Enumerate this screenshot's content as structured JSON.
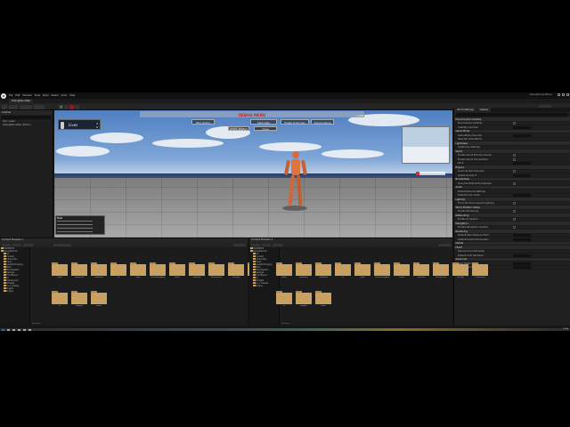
{
  "window": {
    "app_title": "DebugMenuUIMenu",
    "menu": [
      "File",
      "Edit",
      "Window",
      "Tools",
      "Build",
      "Select",
      "Actor",
      "Help"
    ],
    "level_tab": "DebugMenuMap"
  },
  "outliner": {
    "title": "Outliner",
    "rows": [
      "Item Label",
      "DebugMenuMap (Editor)"
    ]
  },
  "viewport": {
    "hud_lives_label": "Lives",
    "hud_lives_value": "3",
    "hud_lives_sub": "0",
    "debug_menu_title": "DEBUG MENU",
    "buttons": [
      "Tab1 Option",
      "Tab2 Opts",
      "Toggle Fullscreen",
      "Toggle Debug"
    ],
    "small_buttons": [
      "LEVEL SELECT",
      "Close"
    ],
    "stats_title": "Stats"
  },
  "details": {
    "tabs": [
      "World Settings",
      "Details"
    ],
    "rows": [
      {
        "label": "Precomputed Visibility",
        "type": "sec"
      },
      {
        "label": "Precompute Visibility",
        "type": "chk"
      },
      {
        "label": "Visibility Cell Size",
        "type": "val"
      },
      {
        "label": "Game Mode",
        "type": "sec"
      },
      {
        "label": "GameMode Override",
        "type": "val"
      },
      {
        "label": "Selected GameMode",
        "type": "row"
      },
      {
        "label": "Lightmass",
        "type": "sec"
      },
      {
        "label": "Lightmass Settings",
        "type": "row"
      },
      {
        "label": "World",
        "type": "sec"
      },
      {
        "label": "Enable World Bounds Checks",
        "type": "chk"
      },
      {
        "label": "Enable World Composition",
        "type": "chk"
      },
      {
        "label": "Kill Z",
        "type": "val"
      },
      {
        "label": "Physics",
        "type": "sec"
      },
      {
        "label": "Override World Gravity",
        "type": "chk"
      },
      {
        "label": "Global Gravity Z",
        "type": "val"
      },
      {
        "label": "Broadphase",
        "type": "sec"
      },
      {
        "label": "Override Default Broadphase",
        "type": "chk"
      },
      {
        "label": "Audio",
        "type": "sec"
      },
      {
        "label": "Default Reverb Settings",
        "type": "row"
      },
      {
        "label": "Default Color Scale",
        "type": "val"
      },
      {
        "label": "Lighting",
        "type": "sec"
      },
      {
        "label": "Force No Precomputed Lighting",
        "type": "chk"
      },
      {
        "label": "World Partition Setup",
        "type": "sec"
      },
      {
        "label": "Enable Streaming",
        "type": "chk"
      },
      {
        "label": "Networking",
        "type": "sec"
      },
      {
        "label": "Enable AI System",
        "type": "chk"
      },
      {
        "label": "Navigation",
        "type": "sec"
      },
      {
        "label": "Enable Navigation System",
        "type": "chk"
      },
      {
        "label": "Rendering",
        "type": "sec"
      },
      {
        "label": "Default Max Distance Field",
        "type": "val"
      },
      {
        "label": "Default Global Illumination",
        "type": "val"
      },
      {
        "label": "Mobile",
        "type": "sec"
      },
      {
        "label": "HLOD",
        "type": "sec"
      },
      {
        "label": "Hierarchical LOD Setup",
        "type": "row"
      },
      {
        "label": "Default LOD Transition",
        "type": "val"
      },
      {
        "label": "Advanced",
        "type": "sec"
      },
      {
        "label": "Num HLOD Levels",
        "type": "val"
      },
      {
        "label": "World Bounds",
        "type": "val"
      }
    ]
  },
  "content_browser_left": {
    "title": "Content Browser 1",
    "path": "Content",
    "tree": [
      "FAVORITES",
      "DebugMenuUI",
      "All",
      "Content",
      "Characters",
      "Input",
      "LevelPrototyping",
      "Main",
      "MenuSystem",
      "Settings",
      "ThirdPerson",
      "UI",
      "UIAdvanced",
      "Widgets",
      "C++ Classes",
      "Plugins",
      "Engine"
    ],
    "folders": [
      "Audio",
      "Blueprints",
      "Characters",
      "Fx",
      "Input",
      "LevelPrototyping",
      "Levels",
      "Materials",
      "MenuSystem",
      "Settings",
      "ThirdPerson",
      "UI",
      "Widgets",
      "Editor"
    ],
    "count": "14 items"
  },
  "content_browser_right": {
    "title": "Content Browser 2",
    "path": "Content",
    "tree": [
      "FAVORITES",
      "DebugMenuUI",
      "All",
      "Content",
      "Characters",
      "Input",
      "LevelPrototyping",
      "Main",
      "MenuSystem",
      "Settings",
      "ThirdPerson",
      "UI",
      "Widgets",
      "C++ Classes",
      "Engine"
    ],
    "folders": [
      "Audio",
      "Blueprints",
      "Characters",
      "Fx",
      "Input",
      "LevelPrototyping",
      "Levels",
      "Materials",
      "MenuSystem",
      "Settings",
      "ThirdPerson",
      "UI",
      "Widgets",
      "Editor"
    ],
    "count": "14 items"
  },
  "taskbar": {
    "clock": "12:00"
  }
}
